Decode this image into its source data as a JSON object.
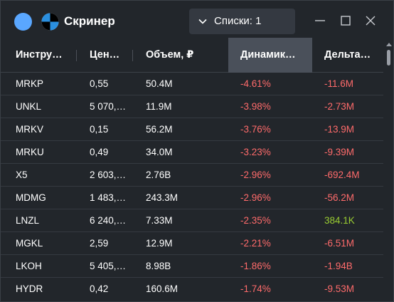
{
  "window": {
    "title": "Скринер",
    "lists_dropdown": "Списки: 1"
  },
  "columns": [
    {
      "key": "ticker",
      "label": "Инстру…"
    },
    {
      "key": "price",
      "label": "Цен…"
    },
    {
      "key": "volume",
      "label": "Объем, ₽"
    },
    {
      "key": "change",
      "label": "Динамик…"
    },
    {
      "key": "delta",
      "label": "Дельта…"
    }
  ],
  "rows": [
    {
      "ticker": "MRKP",
      "price": "0,55",
      "volume": "50.4M",
      "change": "-4.61%",
      "delta": "-11.6M",
      "delta_sign": "neg"
    },
    {
      "ticker": "UNKL",
      "price": "5 070,…",
      "volume": "11.9M",
      "change": "-3.98%",
      "delta": "-2.73M",
      "delta_sign": "neg"
    },
    {
      "ticker": "MRKV",
      "price": "0,15",
      "volume": "56.2M",
      "change": "-3.76%",
      "delta": "-13.9M",
      "delta_sign": "neg"
    },
    {
      "ticker": "MRKU",
      "price": "0,49",
      "volume": "34.0M",
      "change": "-3.23%",
      "delta": "-9.39M",
      "delta_sign": "neg"
    },
    {
      "ticker": "X5",
      "price": "2 603,…",
      "volume": "2.76B",
      "change": "-2.96%",
      "delta": "-692.4M",
      "delta_sign": "neg"
    },
    {
      "ticker": "MDMG",
      "price": "1 483,…",
      "volume": "243.3M",
      "change": "-2.96%",
      "delta": "-56.2M",
      "delta_sign": "neg"
    },
    {
      "ticker": "LNZL",
      "price": "6 240,…",
      "volume": "7.33M",
      "change": "-2.35%",
      "delta": "384.1K",
      "delta_sign": "pos"
    },
    {
      "ticker": "MGKL",
      "price": "2,59",
      "volume": "12.9M",
      "change": "-2.21%",
      "delta": "-6.51M",
      "delta_sign": "neg"
    },
    {
      "ticker": "LKOH",
      "price": "5 405,…",
      "volume": "8.98B",
      "change": "-1.86%",
      "delta": "-1.94B",
      "delta_sign": "neg"
    },
    {
      "ticker": "HYDR",
      "price": "0,42",
      "volume": "160.6M",
      "change": "-1.74%",
      "delta": "-9.53M",
      "delta_sign": "neg"
    }
  ],
  "colors": {
    "negative": "#ff6b6b",
    "positive": "#9acd32",
    "accent": "#5aa7ff"
  },
  "icons": {
    "app": "circle-icon",
    "logo": "quadrant-logo-icon",
    "dropdown": "chevron-down-icon",
    "minimize": "minimize-icon",
    "maximize": "maximize-icon",
    "close": "close-icon"
  }
}
